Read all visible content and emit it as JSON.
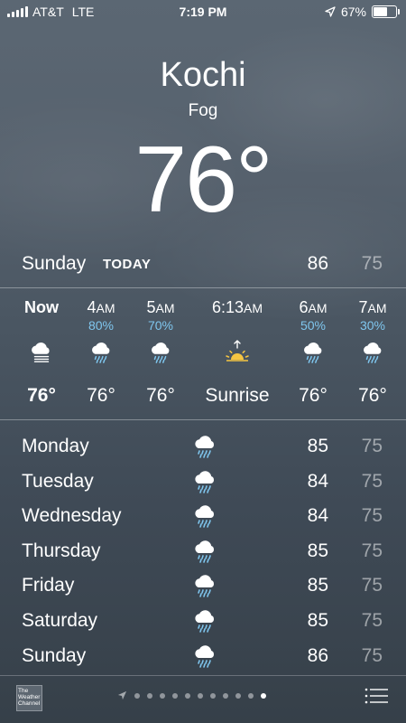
{
  "status_bar": {
    "carrier": "AT&T",
    "network": "LTE",
    "time": "7:19 PM",
    "battery": "67%",
    "battery_level": 0.67
  },
  "current": {
    "city": "Kochi",
    "condition": "Fog",
    "temperature": "76°"
  },
  "today": {
    "day": "Sunday",
    "label": "TODAY",
    "high": "86",
    "low": "75"
  },
  "hourly": [
    {
      "time": "Now",
      "suffix": "",
      "precip": "",
      "icon": "fog-icon",
      "temp": "76°"
    },
    {
      "time": "4",
      "suffix": "AM",
      "precip": "80%",
      "icon": "rain-icon",
      "temp": "76°"
    },
    {
      "time": "5",
      "suffix": "AM",
      "precip": "70%",
      "icon": "rain-icon",
      "temp": "76°"
    },
    {
      "time": "6:13",
      "suffix": "AM",
      "precip": "",
      "icon": "sunrise-icon",
      "temp": "Sunrise"
    },
    {
      "time": "6",
      "suffix": "AM",
      "precip": "50%",
      "icon": "rain-icon",
      "temp": "76°"
    },
    {
      "time": "7",
      "suffix": "AM",
      "precip": "30%",
      "icon": "rain-icon",
      "temp": "76°"
    }
  ],
  "daily": [
    {
      "day": "Monday",
      "icon": "rain-icon",
      "high": "85",
      "low": "75"
    },
    {
      "day": "Tuesday",
      "icon": "rain-icon",
      "high": "84",
      "low": "75"
    },
    {
      "day": "Wednesday",
      "icon": "rain-icon",
      "high": "84",
      "low": "75"
    },
    {
      "day": "Thursday",
      "icon": "rain-icon",
      "high": "85",
      "low": "75"
    },
    {
      "day": "Friday",
      "icon": "rain-icon",
      "high": "85",
      "low": "75"
    },
    {
      "day": "Saturday",
      "icon": "rain-icon",
      "high": "85",
      "low": "75"
    },
    {
      "day": "Sunday",
      "icon": "rain-icon",
      "high": "86",
      "low": "75"
    }
  ],
  "footer": {
    "logo_text": "The Weather Channel",
    "page_count": 11,
    "active_page": 11
  },
  "colors": {
    "precip": "#7fc6ee",
    "sun": "#f5c542"
  }
}
